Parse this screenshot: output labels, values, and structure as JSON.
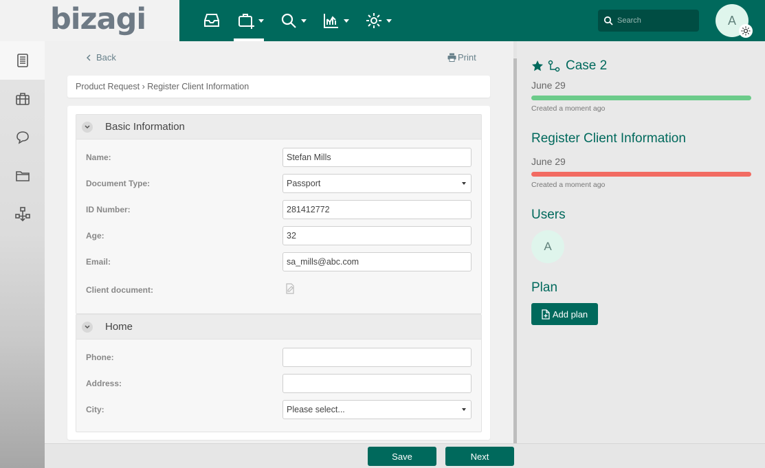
{
  "app": {
    "logo": "bizagi"
  },
  "topbar": {
    "nav": [
      {
        "name": "inbox"
      },
      {
        "name": "new-case",
        "active": true
      },
      {
        "name": "search-menu"
      },
      {
        "name": "analytics"
      },
      {
        "name": "admin"
      }
    ],
    "search": {
      "placeholder": "Search"
    },
    "avatar_initial": "A"
  },
  "sidebar": {
    "items": [
      "summary",
      "work-portal",
      "comments",
      "files",
      "process"
    ]
  },
  "main": {
    "back": "Back",
    "print": "Print",
    "breadcrumb": "Product Request › Register Client Information",
    "groups": [
      {
        "title": "Basic Information",
        "fields": [
          {
            "label": "Name:",
            "value": "Stefan Mills",
            "type": "text"
          },
          {
            "label": "Document Type:",
            "value": "Passport",
            "type": "select"
          },
          {
            "label": "ID Number:",
            "value": "281412772",
            "type": "text"
          },
          {
            "label": "Age:",
            "value": "32",
            "type": "text"
          },
          {
            "label": "Email:",
            "value": "sa_mills@abc.com",
            "type": "text"
          },
          {
            "label": "Client document:",
            "value": "",
            "type": "file"
          }
        ]
      },
      {
        "title": "Home",
        "fields": [
          {
            "label": "Phone:",
            "value": "",
            "type": "text"
          },
          {
            "label": "Address:",
            "value": "",
            "type": "text"
          },
          {
            "label": "City:",
            "value": "Please select...",
            "type": "select"
          }
        ]
      }
    ]
  },
  "actions": {
    "save": "Save",
    "next": "Next"
  },
  "right_panel": {
    "case": {
      "title": "Case 2",
      "date": "June 29",
      "created": "Created a moment ago",
      "bar_color": "#6ccb8a"
    },
    "task": {
      "title": "Register Client Information",
      "date": "June 29",
      "created": "Created a moment ago",
      "bar_color": "#f26b62"
    },
    "users": {
      "title": "Users",
      "initial": "A"
    },
    "plan": {
      "title": "Plan",
      "button": "Add plan"
    }
  },
  "colors": {
    "brand": "#00695c",
    "logo": "#6e7a85"
  }
}
